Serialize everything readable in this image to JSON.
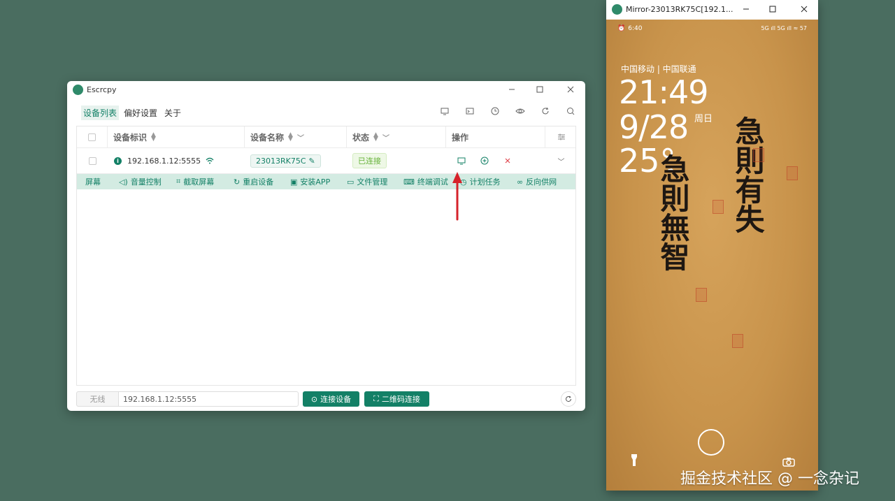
{
  "app": {
    "title": "Escrcpy",
    "tabs": [
      "设备列表",
      "偏好设置",
      "关于"
    ],
    "toolbar_icons": [
      "monitor-icon",
      "terminal-icon",
      "history-icon",
      "eye-icon",
      "refresh-icon",
      "search-icon"
    ],
    "table": {
      "headers": {
        "id": "设备标识",
        "name": "设备名称",
        "status": "状态",
        "ops": "操作"
      },
      "row": {
        "id": "192.168.1.12:5555",
        "name": "23013RK75C",
        "status": "已连接"
      }
    },
    "actions": [
      "屏幕",
      "音量控制",
      "截取屏幕",
      "重启设备",
      "安装APP",
      "文件管理",
      "终端调试",
      "计划任务",
      "反向供网"
    ],
    "bottom": {
      "mode": "无线",
      "address": "192.168.1.12:5555",
      "connect_btn": "连接设备",
      "qr_btn": "二维码连接"
    },
    "colors": {
      "primary": "#138066",
      "success": "#67b23a",
      "arrow": "#d6232b",
      "desktop": "#4a6d60"
    }
  },
  "mirror": {
    "title": "Mirror-23013RK75C[192.1...",
    "status_time": "6:40",
    "status_right": "5G ıll 5G ıll ≈ 57",
    "carrier": "中国移动 | 中国联通",
    "clock": "21:49",
    "date": "9/28",
    "weekday": "周日",
    "temp": "25°",
    "callig_right": "急則有失",
    "callig_left": "急則無智"
  },
  "watermark": "掘金技术社区 @ 一念杂记"
}
